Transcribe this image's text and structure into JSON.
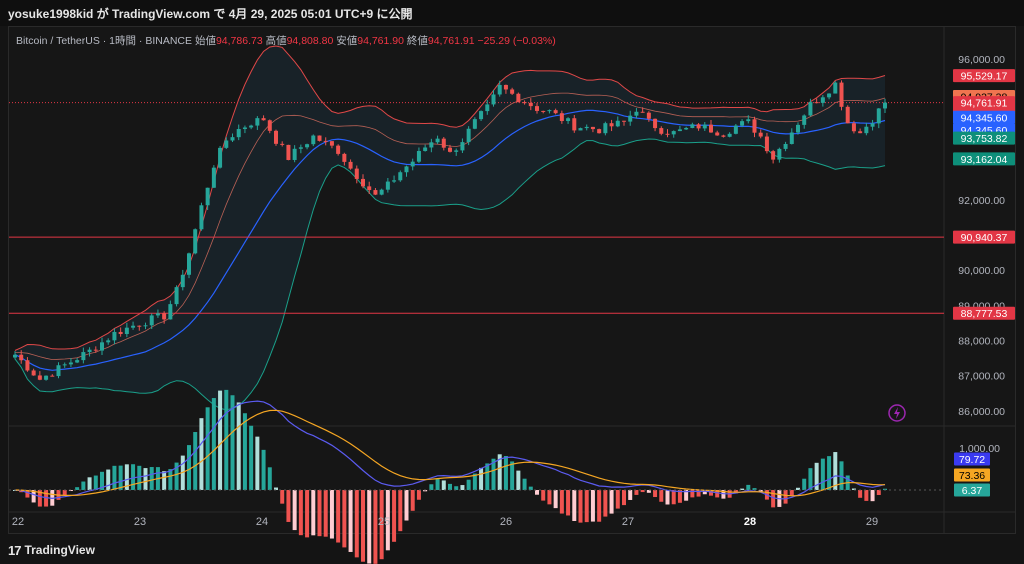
{
  "header": {
    "title": "yosuke1998kid が TradingView.com で 4月 29, 2025 05:01 UTC+9 に公開"
  },
  "legend": {
    "symbol": "Bitcoin / TetherUS · 1時間 · BINANCE",
    "open_label": "始値",
    "open": "94,786.73",
    "high_label": "高値",
    "high": "94,808.80",
    "low_label": "安値",
    "low": "94,761.90",
    "close_label": "終値",
    "close": "94,761.91",
    "change": "−25.29 (−0.03%)"
  },
  "footer": {
    "brand": "TradingView"
  },
  "colors": {
    "up": "#26a69a",
    "down": "#ef5350",
    "bb_upper": "#e04848",
    "bb_basis": "#2962ff",
    "bb_lower": "#1aa08a",
    "bb2_upper": "#e07060",
    "macd": "#5b5bf0",
    "signal": "#f5a623",
    "hline": "#e23645"
  },
  "chart_data": {
    "type": "candlestick",
    "symbol": "BTCUSDT",
    "interval": "1時間",
    "exchange": "BINANCE",
    "x_labels": [
      "22",
      "23",
      "24",
      "25",
      "26",
      "27",
      "28",
      "29"
    ],
    "y_axis": {
      "ylim": [
        85600,
        96400
      ],
      "ticks": [
        86000,
        87000,
        88000,
        89000,
        90000,
        92000,
        96000
      ]
    },
    "y_tick_labels": [
      "86,000.00",
      "87,000.00",
      "88,000.00",
      "89,000.00",
      "90,000.00",
      "92,000.00",
      "96,000.00"
    ],
    "hlines": [
      {
        "value": 90940.37,
        "label": "90,940.37"
      },
      {
        "value": 88777.53,
        "label": "88,777.53"
      }
    ],
    "price_labels": [
      {
        "text": "95,529.17",
        "value": 95529.17,
        "color": "#e23645",
        "text_color": "#ffffff"
      },
      {
        "text": "94,937.38",
        "value": 94937.38,
        "color": "#f0744f",
        "text_color": "#000000"
      },
      {
        "text": "94,761.91",
        "value": 94761.91,
        "color": "#e23645",
        "text_color": "#ffffff",
        "sub": "58:42"
      },
      {
        "text": "94,345.60",
        "value": 94345.6,
        "color": "#2962ff",
        "text_color": "#ffffff"
      },
      {
        "text": "94,345.60",
        "value": 93990,
        "color": "#2962ff",
        "text_color": "#ffffff"
      },
      {
        "text": "93,753.82",
        "value": 93753.82,
        "color": "#0e8f7a",
        "text_color": "#ffffff"
      },
      {
        "text": "93,162.04",
        "value": 93162.04,
        "color": "#0e8f7a",
        "text_color": "#ffffff"
      }
    ],
    "price_path": [
      [
        0,
        87600
      ],
      [
        4,
        86900
      ],
      [
        8,
        87300
      ],
      [
        12,
        87700
      ],
      [
        16,
        88200
      ],
      [
        20,
        88500
      ],
      [
        24,
        88700
      ],
      [
        26,
        89400
      ],
      [
        28,
        90500
      ],
      [
        30,
        91800
      ],
      [
        32,
        93000
      ],
      [
        34,
        93700
      ],
      [
        36,
        94000
      ],
      [
        38,
        94200
      ],
      [
        40,
        94300
      ],
      [
        42,
        93700
      ],
      [
        44,
        93200
      ],
      [
        46,
        93500
      ],
      [
        48,
        93800
      ],
      [
        50,
        93600
      ],
      [
        52,
        93400
      ],
      [
        54,
        92900
      ],
      [
        56,
        92500
      ],
      [
        58,
        92100
      ],
      [
        60,
        92400
      ],
      [
        62,
        92800
      ],
      [
        64,
        93100
      ],
      [
        66,
        93500
      ],
      [
        68,
        93800
      ],
      [
        70,
        93300
      ],
      [
        72,
        93700
      ],
      [
        74,
        94200
      ],
      [
        76,
        94600
      ],
      [
        78,
        95200
      ],
      [
        80,
        95000
      ],
      [
        82,
        94800
      ],
      [
        84,
        94600
      ],
      [
        86,
        94500
      ],
      [
        88,
        94300
      ],
      [
        90,
        94100
      ],
      [
        92,
        94050
      ],
      [
        94,
        94000
      ],
      [
        96,
        94100
      ],
      [
        98,
        94200
      ],
      [
        100,
        94600
      ],
      [
        102,
        94200
      ],
      [
        104,
        94000
      ],
      [
        106,
        93900
      ],
      [
        108,
        94000
      ],
      [
        110,
        94100
      ],
      [
        112,
        94000
      ],
      [
        114,
        93900
      ],
      [
        116,
        94100
      ],
      [
        118,
        94200
      ],
      [
        120,
        93800
      ],
      [
        122,
        93200
      ],
      [
        124,
        93700
      ],
      [
        126,
        94200
      ],
      [
        128,
        94700
      ],
      [
        130,
        95000
      ],
      [
        132,
        95300
      ],
      [
        134,
        94200
      ],
      [
        136,
        93900
      ],
      [
        138,
        94300
      ],
      [
        140,
        94760
      ]
    ],
    "indicator": {
      "type": "macd",
      "y_tick_labels": [
        "1,000.00"
      ],
      "labels": [
        {
          "text": "79.72",
          "color": "#3a3af0"
        },
        {
          "text": "73.36",
          "color": "#f5a623"
        },
        {
          "text": "6.37",
          "color": "#26a69a"
        }
      ]
    }
  }
}
